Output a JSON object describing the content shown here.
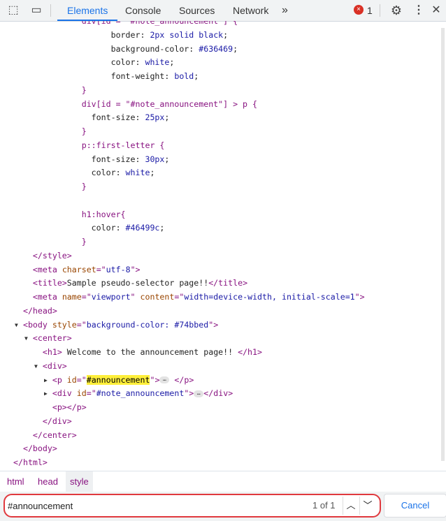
{
  "toolbar": {
    "tabs": [
      {
        "label": "Elements",
        "active": true
      },
      {
        "label": "Console"
      },
      {
        "label": "Sources"
      },
      {
        "label": "Network"
      }
    ],
    "more_tabs": "»",
    "error_count": "1",
    "icons": [
      "inspect-element-icon",
      "device-toolbar-icon",
      "error-icon",
      "gear-icon",
      "more-vertical-icon",
      "close-icon"
    ]
  },
  "code_lines": [
    {
      "segs": [
        [
          "sel",
          "              div[id = \"#note_announcement\"] {"
        ]
      ]
    },
    {
      "segs": [
        [
          "prop",
          "                    border: "
        ],
        [
          "num",
          "2px solid black"
        ],
        [
          "prop",
          ";"
        ]
      ]
    },
    {
      "segs": [
        [
          "prop",
          "                    background-color: "
        ],
        [
          "num",
          "#636469"
        ],
        [
          "prop",
          ";"
        ]
      ]
    },
    {
      "segs": [
        [
          "prop",
          "                    color: "
        ],
        [
          "num",
          "white"
        ],
        [
          "prop",
          ";"
        ]
      ]
    },
    {
      "segs": [
        [
          "prop",
          "                    font-weight: "
        ],
        [
          "num",
          "bold"
        ],
        [
          "prop",
          ";"
        ]
      ]
    },
    {
      "segs": [
        [
          "sel",
          "              }"
        ]
      ]
    },
    {
      "segs": [
        [
          "sel",
          "              div[id = \"#note_announcement\"] > p {"
        ]
      ]
    },
    {
      "segs": [
        [
          "prop",
          "                font-size: "
        ],
        [
          "num",
          "25px"
        ],
        [
          "prop",
          ";"
        ]
      ]
    },
    {
      "segs": [
        [
          "sel",
          "              }"
        ]
      ]
    },
    {
      "segs": [
        [
          "sel",
          "              p::first-letter {"
        ]
      ]
    },
    {
      "segs": [
        [
          "prop",
          "                font-size: "
        ],
        [
          "num",
          "30px"
        ],
        [
          "prop",
          ";"
        ]
      ]
    },
    {
      "segs": [
        [
          "prop",
          "                color: "
        ],
        [
          "num",
          "white"
        ],
        [
          "prop",
          ";"
        ]
      ]
    },
    {
      "segs": [
        [
          "sel",
          "              }"
        ]
      ]
    },
    {
      "segs": []
    },
    {
      "segs": [
        [
          "sel",
          "              h1:hover{"
        ]
      ]
    },
    {
      "segs": [
        [
          "prop",
          "                color: "
        ],
        [
          "num",
          "#46499c"
        ],
        [
          "prop",
          ";"
        ]
      ]
    },
    {
      "segs": [
        [
          "sel",
          "              }"
        ]
      ]
    },
    {
      "segs": [
        [
          "tag",
          "    </style>"
        ]
      ]
    },
    {
      "segs": [
        [
          "tag",
          "    <meta "
        ],
        [
          "attr",
          "charset"
        ],
        [
          "tag",
          "=\""
        ],
        [
          "val",
          "utf-8"
        ],
        [
          "tag",
          "\">"
        ]
      ]
    },
    {
      "segs": [
        [
          "tag",
          "    <title>"
        ],
        [
          "text",
          "Sample pseudo-selector page!!"
        ],
        [
          "tag",
          "</title>"
        ]
      ]
    },
    {
      "segs": [
        [
          "tag",
          "    <meta "
        ],
        [
          "attr",
          "name"
        ],
        [
          "tag",
          "=\""
        ],
        [
          "val",
          "viewport"
        ],
        [
          "tag",
          "\" "
        ],
        [
          "attr",
          "content"
        ],
        [
          "tag",
          "=\""
        ],
        [
          "val",
          "width=device-width, initial-scale=1"
        ],
        [
          "tag",
          "\">"
        ]
      ]
    },
    {
      "segs": [
        [
          "tag",
          "  </head>"
        ]
      ]
    },
    {
      "tri": "down",
      "segs": [
        [
          "tag",
          "  <body "
        ],
        [
          "attr",
          "style"
        ],
        [
          "tag",
          "=\""
        ],
        [
          "val",
          "background-color: #74bbed"
        ],
        [
          "tag",
          "\">"
        ]
      ]
    },
    {
      "tri": "down",
      "segs": [
        [
          "tag",
          "    <center>"
        ]
      ]
    },
    {
      "segs": [
        [
          "tag",
          "      <h1>"
        ],
        [
          "text",
          " Welcome to the announcement page!! "
        ],
        [
          "tag",
          "</h1>"
        ]
      ]
    },
    {
      "tri": "down",
      "segs": [
        [
          "tag",
          "      <div>"
        ]
      ]
    },
    {
      "tri": "right",
      "segs": [
        [
          "tag",
          "        <p "
        ],
        [
          "attr",
          "id"
        ],
        [
          "tag",
          "=\""
        ],
        [
          "hl",
          "#announcement"
        ],
        [
          "tag",
          "\">"
        ],
        [
          "dots",
          "…"
        ],
        [
          "tag",
          " </p>"
        ]
      ]
    },
    {
      "tri": "right",
      "segs": [
        [
          "tag",
          "        <div "
        ],
        [
          "attr",
          "id"
        ],
        [
          "tag",
          "=\""
        ],
        [
          "val",
          "#note_announcement"
        ],
        [
          "tag",
          "\">"
        ],
        [
          "dots",
          "…"
        ],
        [
          "tag",
          "</div>"
        ]
      ]
    },
    {
      "segs": [
        [
          "tag",
          "        <p></p>"
        ]
      ]
    },
    {
      "segs": [
        [
          "tag",
          "      </div>"
        ]
      ]
    },
    {
      "segs": [
        [
          "tag",
          "    </center>"
        ]
      ]
    },
    {
      "segs": [
        [
          "tag",
          "  </body>"
        ]
      ]
    },
    {
      "segs": [
        [
          "tag",
          "</html>"
        ]
      ]
    }
  ],
  "breadcrumbs": [
    {
      "label": "html"
    },
    {
      "label": "head"
    },
    {
      "label": "style",
      "selected": true
    }
  ],
  "find": {
    "value": "#announcement",
    "match_count": "1 of 1",
    "prev_label": "^",
    "next_label": "v",
    "cancel_label": "Cancel"
  },
  "colors": {
    "accent": "#1a73e8",
    "highlight": "#ffef3a",
    "find_outline": "#e0393e",
    "error": "#d93025"
  }
}
